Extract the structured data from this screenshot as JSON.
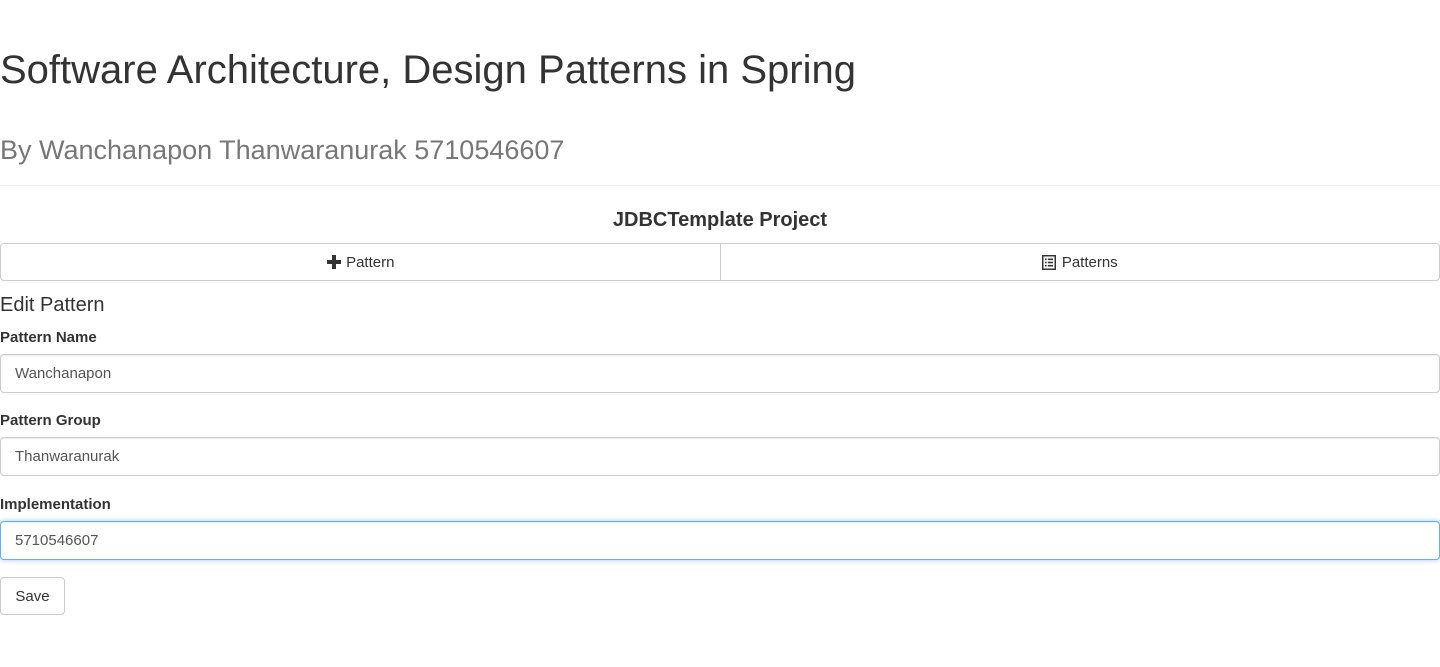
{
  "header": {
    "title": "Software Architecture, Design Patterns in Spring",
    "subtitle": "By Wanchanapon Thanwaranurak 5710546607"
  },
  "project": {
    "title": "JDBCTemplate Project"
  },
  "nav": {
    "add_pattern_label": "Pattern",
    "add_pattern_icon": "plus-icon",
    "patterns_label": "Patterns",
    "patterns_icon": "list-alt-icon"
  },
  "form": {
    "heading": "Edit Pattern",
    "fields": [
      {
        "label": "Pattern Name",
        "value": "Wanchanapon"
      },
      {
        "label": "Pattern Group",
        "value": "Thanwaranurak"
      },
      {
        "label": "Implementation",
        "value": "5710546607"
      }
    ],
    "save_label": "Save"
  },
  "colors": {
    "text": "#333333",
    "muted": "#777777",
    "border": "#cccccc",
    "focus": "#66afe9"
  }
}
